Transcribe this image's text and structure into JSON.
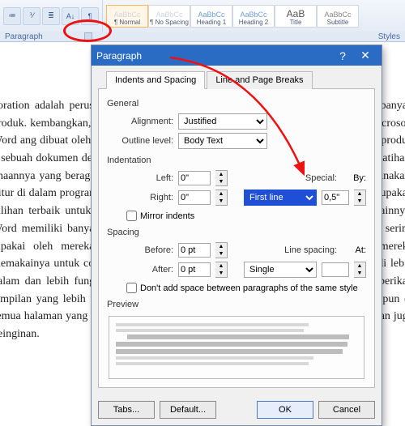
{
  "ribbon": {
    "group_paragraph": "Paragraph",
    "group_styles": "Styles",
    "style_items": [
      "¶ Normal",
      "¶ No Spacing",
      "Heading 1",
      "Heading 2",
      "Title",
      "Subtitle"
    ]
  },
  "doc_text": "poration adalah perusahaan yang berada di Amerika Serikat, yang menghasilkan banyak produk. kembangkan, dibuatlah paket aplikasi gunakan Microsoft Word. Aplikasi Microsoft Word ang dibuat oleh Microsoft Corporation. Microsoft Word merupakan salah satu produk k sebuah dokumen dengan cepat. Aaplikasi ini dapat dipakai secara praktis tanpa pelatihan. unaannya yang beragam dan membantu pekerjaan.\n\nenangi karena mudah untuk digunakan. Fitur di dalam program yang tersedia dalam a dalam pembuatan dokumen. Word merupakan pilihan terbaik untuk menulis dan bisa posal, laporan, surat, dan tulisan-tulisan lainnya. Word memiliki banyak kemudahan unakan adalah bingkai. Fitur satu ini memang sering dipakai oleh mereka yang agar terlihat.\n\nkai di sampul tengah. Umumnya mereka memakainya untuk cover tugas saja. Padahal bisa an menemukan fitur bingkai ini di lebih dalam dan lebih fungsional di dalam ainnya. Adanya fitur bingkai ini bisa memberikan tampilan yang lebih menarik kontras buat bingkai di salah satu halaman saja maupun di semua halaman yang sedang dibuat. k motif bingkai yang bisa dipilih sesuai selera dan juga keinginan.",
  "dialog": {
    "title": "Paragraph",
    "tabs": {
      "indents": "Indents and Spacing",
      "breaks": "Line and Page Breaks"
    },
    "section_general": "General",
    "label_alignment": "Alignment:",
    "value_alignment": "Justified",
    "label_outline": "Outline level:",
    "value_outline": "Body Text",
    "section_indentation": "Indentation",
    "label_left": "Left:",
    "value_left": "0\"",
    "label_right": "Right:",
    "value_right": "0\"",
    "label_special": "Special:",
    "value_special": "First line",
    "label_by": "By:",
    "value_by": "0,5\"",
    "chk_mirror": "Mirror indents",
    "section_spacing": "Spacing",
    "label_before": "Before:",
    "value_before": "0 pt",
    "label_after": "After:",
    "value_after": "0 pt",
    "label_linespacing": "Line spacing:",
    "value_linespacing": "Single",
    "label_at": "At:",
    "value_at": "",
    "chk_nospace": "Don't add space between paragraphs of the same style",
    "section_preview": "Preview",
    "btn_tabs": "Tabs...",
    "btn_default": "Default...",
    "btn_ok": "OK",
    "btn_cancel": "Cancel"
  }
}
